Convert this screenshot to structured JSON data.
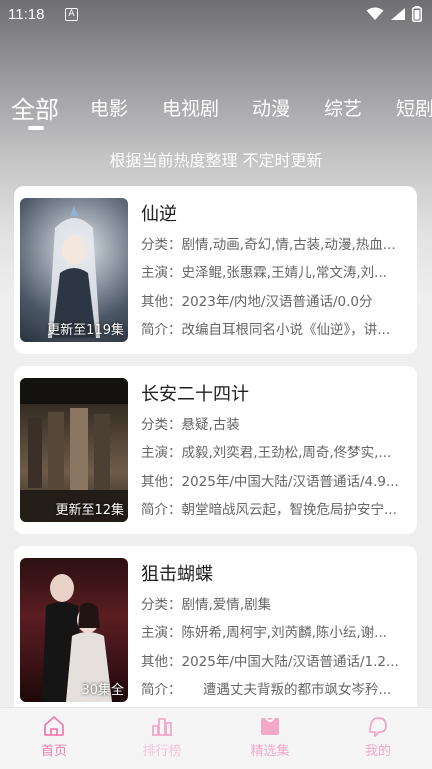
{
  "status": {
    "time": "11:18",
    "notif": "A"
  },
  "tabs": [
    "全部",
    "电影",
    "电视剧",
    "动漫",
    "综艺",
    "短剧"
  ],
  "subtitle": "根据当前热度整理 不定时更新",
  "cards": [
    {
      "title": "仙逆",
      "badge": "更新至119集",
      "genre": "分类：剧情,动画,奇幻,情,古装,动漫,热血...",
      "cast": "主演：史泽鲲,张惠霖,王婧儿,常文涛,刘...",
      "other": "其他：2023年/内地/汉语普通话/0.0分",
      "intro": "简介：改编自耳根同名小说《仙逆》，讲...",
      "poster_colors": [
        "#3a4556",
        "#6f7a88",
        "#c9ccd3"
      ]
    },
    {
      "title": "长安二十四计",
      "badge": "更新至12集",
      "genre": "分类：悬疑,古装",
      "cast": "主演：成毅,刘奕君,王劲松,周奇,佟梦实,...",
      "other": "其他：2025年/中国大陆/汉语普通话/4.9...",
      "intro": "简介：朝堂暗战风云起，智挽危局护安宁...",
      "poster_colors": [
        "#2a2420",
        "#5a4a3a",
        "#8a7660"
      ]
    },
    {
      "title": "狙击蝴蝶",
      "badge": "30集全",
      "genre": "分类：剧情,爱情,剧集",
      "cast": "主演：陈妍希,周柯宇,刘芮麟,陈小纭,谢...",
      "other": "其他：2025年/中国大陆/汉语普通话/1.2...",
      "intro": "简介：     遭遇丈夫背叛的都市飒女岑矜...",
      "poster_colors": [
        "#3a1418",
        "#7a2a2e",
        "#d8c0bc"
      ]
    }
  ],
  "nav": [
    {
      "label": "首页",
      "icon": "home-icon"
    },
    {
      "label": "排行榜",
      "icon": "ranking-icon"
    },
    {
      "label": "精选集",
      "icon": "collection-icon"
    },
    {
      "label": "我的",
      "icon": "profile-icon"
    }
  ],
  "colors": {
    "accent": "#ef7fb0",
    "accent_light": "#f6c4da",
    "card_bg": "#ffffff"
  }
}
